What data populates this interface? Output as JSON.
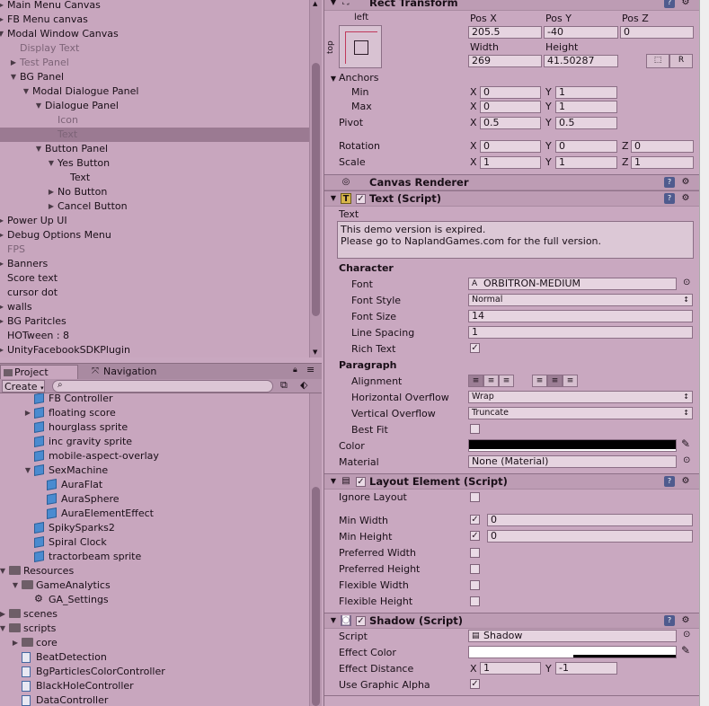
{
  "hierarchy": {
    "items": [
      {
        "label": "Main Menu Canvas",
        "tri": "▶"
      },
      {
        "label": "FB Menu canvas",
        "tri": "▶"
      },
      {
        "label": "Modal Window Canvas",
        "tri": "▼"
      },
      {
        "label": "Display Text",
        "tri": ""
      },
      {
        "label": "Test Panel",
        "tri": "▶"
      },
      {
        "label": "BG Panel",
        "tri": "▼"
      },
      {
        "label": "Modal Dialogue Panel",
        "tri": "▼"
      },
      {
        "label": "Dialogue Panel",
        "tri": "▼"
      },
      {
        "label": "Icon",
        "tri": ""
      },
      {
        "label": "Text",
        "tri": ""
      },
      {
        "label": "Button Panel",
        "tri": "▼"
      },
      {
        "label": "Yes Button",
        "tri": "▼"
      },
      {
        "label": "Text",
        "tri": ""
      },
      {
        "label": "No Button",
        "tri": "▶"
      },
      {
        "label": "Cancel Button",
        "tri": "▶"
      },
      {
        "label": "Power Up UI",
        "tri": "▶"
      },
      {
        "label": "Debug Options Menu",
        "tri": "▶"
      },
      {
        "label": "FPS",
        "tri": ""
      },
      {
        "label": "Banners",
        "tri": "▶"
      },
      {
        "label": "Score text",
        "tri": ""
      },
      {
        "label": "cursor dot",
        "tri": ""
      },
      {
        "label": "walls",
        "tri": "▶"
      },
      {
        "label": "BG Paritcles",
        "tri": "▶"
      },
      {
        "label": "HOTween : 8",
        "tri": ""
      },
      {
        "label": "UnityFacebookSDKPlugin",
        "tri": "▶"
      }
    ]
  },
  "project": {
    "tabs": [
      {
        "label": "Project",
        "icon": "folder-icon"
      },
      {
        "label": "Navigation",
        "icon": "navigation-icon"
      }
    ],
    "create_label": "Create",
    "search_placeholder": "",
    "items": [
      {
        "label": "FB Controller",
        "icon": "cube",
        "tri": ""
      },
      {
        "label": "floating score",
        "icon": "cube",
        "tri": "▶"
      },
      {
        "label": "hourglass sprite",
        "icon": "cube",
        "tri": ""
      },
      {
        "label": "inc gravity sprite",
        "icon": "cube",
        "tri": ""
      },
      {
        "label": "mobile-aspect-overlay",
        "icon": "cube",
        "tri": ""
      },
      {
        "label": "SexMachine",
        "icon": "cube",
        "tri": "▼"
      },
      {
        "label": "AuraFlat",
        "icon": "cube",
        "tri": ""
      },
      {
        "label": "AuraSphere",
        "icon": "cube",
        "tri": ""
      },
      {
        "label": "AuraElementEffect",
        "icon": "cube",
        "tri": ""
      },
      {
        "label": "SpikySparks2",
        "icon": "cube",
        "tri": ""
      },
      {
        "label": "Spiral Clock",
        "icon": "cube",
        "tri": ""
      },
      {
        "label": "tractorbeam sprite",
        "icon": "cube",
        "tri": ""
      },
      {
        "label": "Resources",
        "icon": "folder",
        "tri": "▼"
      },
      {
        "label": "GameAnalytics",
        "icon": "folder",
        "tri": "▼"
      },
      {
        "label": "GA_Settings",
        "icon": "settings",
        "tri": ""
      },
      {
        "label": "scenes",
        "icon": "folder",
        "tri": "▶"
      },
      {
        "label": "scripts",
        "icon": "folder",
        "tri": "▼"
      },
      {
        "label": "core",
        "icon": "folder",
        "tri": "▶"
      },
      {
        "label": "BeatDetection",
        "icon": "script",
        "tri": ""
      },
      {
        "label": "BgParticlesColorController",
        "icon": "script",
        "tri": ""
      },
      {
        "label": "BlackHoleController",
        "icon": "script",
        "tri": ""
      },
      {
        "label": "DataController",
        "icon": "script",
        "tri": ""
      }
    ]
  },
  "inspector": {
    "rect_transform": {
      "title": "Rect Transform",
      "anchor_h": "left",
      "anchor_v": "top",
      "pos_x_label": "Pos X",
      "pos_y_label": "Pos Y",
      "pos_z_label": "Pos Z",
      "pos_x": "205.5",
      "pos_y": "-40",
      "pos_z": "0",
      "width_label": "Width",
      "height_label": "Height",
      "width": "269",
      "height": "41.50287",
      "raw_button": "R",
      "anchors_label": "Anchors",
      "min_label": "Min",
      "max_label": "Max",
      "min_x": "0",
      "min_y": "1",
      "max_x": "0",
      "max_y": "1",
      "pivot_label": "Pivot",
      "pivot_x": "0.5",
      "pivot_y": "0.5",
      "rotation_label": "Rotation",
      "rot_x": "0",
      "rot_y": "0",
      "rot_z": "0",
      "scale_label": "Scale",
      "scale_x": "1",
      "scale_y": "1",
      "scale_z": "1",
      "x": "X",
      "y": "Y",
      "z": "Z"
    },
    "canvas_renderer": {
      "title": "Canvas Renderer"
    },
    "text_script": {
      "title": "Text (Script)",
      "text_label": "Text",
      "text_line1": "This demo version is expired.",
      "text_line2": "Please go to NaplandGames.com for the full version.",
      "character_label": "Character",
      "font_label": "Font",
      "font_value": "ORBITRON-MEDIUM",
      "font_style_label": "Font Style",
      "font_style_value": "Normal",
      "font_size_label": "Font Size",
      "font_size_value": "14",
      "line_spacing_label": "Line Spacing",
      "line_spacing_value": "1",
      "rich_text_label": "Rich Text",
      "paragraph_label": "Paragraph",
      "alignment_label": "Alignment",
      "h_overflow_label": "Horizontal Overflow",
      "h_overflow_value": "Wrap",
      "v_overflow_label": "Vertical Overflow",
      "v_overflow_value": "Truncate",
      "best_fit_label": "Best Fit",
      "color_label": "Color",
      "color_value": "#000000",
      "material_label": "Material",
      "material_value": "None (Material)"
    },
    "layout_element": {
      "title": "Layout Element (Script)",
      "ignore_layout_label": "Ignore Layout",
      "min_width_label": "Min Width",
      "min_width_value": "0",
      "min_height_label": "Min Height",
      "min_height_value": "0",
      "preferred_width_label": "Preferred Width",
      "preferred_height_label": "Preferred Height",
      "flexible_width_label": "Flexible Width",
      "flexible_height_label": "Flexible Height"
    },
    "shadow": {
      "title": "Shadow (Script)",
      "script_label": "Script",
      "script_value": "Shadow",
      "effect_color_label": "Effect Color",
      "effect_color_value": "#ffffff",
      "effect_distance_label": "Effect Distance",
      "dist_x": "1",
      "dist_y": "-1",
      "use_graphic_alpha_label": "Use Graphic Alpha"
    }
  }
}
